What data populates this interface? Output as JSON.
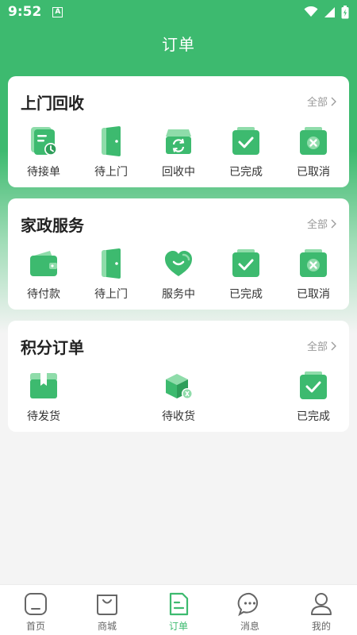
{
  "status_bar": {
    "time": "9:52",
    "notice_glyph": "A"
  },
  "nav": {
    "title": "订单"
  },
  "colors": {
    "brand": "#3dba6f",
    "brand_light": "#8fdcaa",
    "text": "#333333",
    "muted": "#999999"
  },
  "sections": [
    {
      "title": "上门回收",
      "all_label": "全部",
      "items": [
        {
          "label": "待接单",
          "icon": "document-clock-icon"
        },
        {
          "label": "待上门",
          "icon": "door-icon"
        },
        {
          "label": "回收中",
          "icon": "recycle-box-icon"
        },
        {
          "label": "已完成",
          "icon": "check-clipboard-icon"
        },
        {
          "label": "已取消",
          "icon": "cancel-clipboard-icon"
        }
      ]
    },
    {
      "title": "家政服务",
      "all_label": "全部",
      "items": [
        {
          "label": "待付款",
          "icon": "wallet-icon"
        },
        {
          "label": "待上门",
          "icon": "door-icon"
        },
        {
          "label": "服务中",
          "icon": "heart-smile-icon"
        },
        {
          "label": "已完成",
          "icon": "check-clipboard-icon"
        },
        {
          "label": "已取消",
          "icon": "cancel-clipboard-icon"
        }
      ]
    },
    {
      "title": "积分订单",
      "all_label": "全部",
      "items": [
        {
          "label": "待发货",
          "icon": "package-icon"
        },
        {
          "label": "待收货",
          "icon": "delivery-box-icon"
        },
        {
          "label": "已完成",
          "icon": "check-clipboard-icon"
        }
      ]
    }
  ],
  "tabbar": [
    {
      "label": "首页",
      "icon": "home-icon",
      "active": false
    },
    {
      "label": "商城",
      "icon": "shopping-bag-icon",
      "active": false
    },
    {
      "label": "订单",
      "icon": "order-icon",
      "active": true
    },
    {
      "label": "消息",
      "icon": "message-icon",
      "active": false
    },
    {
      "label": "我的",
      "icon": "user-icon",
      "active": false
    }
  ]
}
